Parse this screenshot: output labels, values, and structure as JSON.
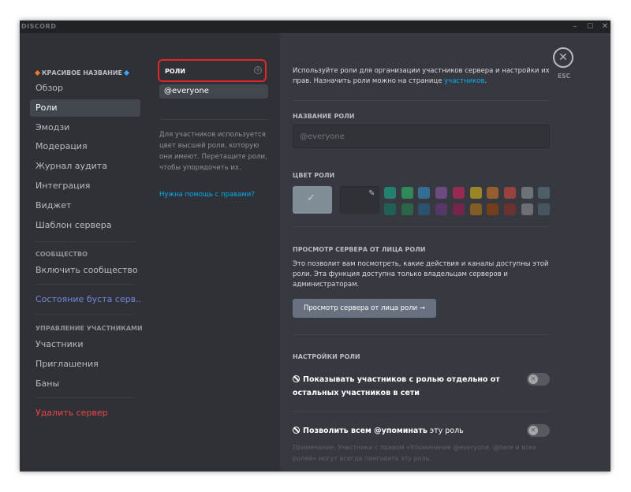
{
  "window": {
    "logo": "DISCORD",
    "minimize_glyph": "–",
    "maximize_glyph": "☐",
    "close_glyph": "✕"
  },
  "sidebar": {
    "server_name": "КРАСИВОЕ НАЗВАНИЕ",
    "items": [
      {
        "label": "Обзор"
      },
      {
        "label": "Роли",
        "selected": true
      },
      {
        "label": "Эмодзи"
      },
      {
        "label": "Модерация"
      },
      {
        "label": "Журнал аудита"
      },
      {
        "label": "Интеграция"
      },
      {
        "label": "Виджет"
      },
      {
        "label": "Шаблон сервера"
      }
    ],
    "community_header": "СООБЩЕСТВО",
    "enable_community": "Включить сообщество",
    "boost_status": "Состояние буста серв...",
    "members_header": "УПРАВЛЕНИЕ УЧАСТНИКАМИ",
    "member_items": [
      {
        "label": "Участники"
      },
      {
        "label": "Приглашения"
      },
      {
        "label": "Баны"
      }
    ],
    "delete_server": "Удалить сервер"
  },
  "roles_column": {
    "header": "РОЛИ",
    "add_glyph": "+",
    "roles": [
      {
        "name": "@everyone"
      }
    ],
    "hint": "Для участников используется цвет высшей роли, которую они имеют. Перетащите роли, чтобы упорядочить их.",
    "help_link": "Нужна помощь с правами?"
  },
  "content": {
    "intro_text": "Используйте роли для организации участников сервера и настройки их прав. Назначить роли можно на странице ",
    "intro_link": "участников",
    "intro_end": ".",
    "role_name_label": "НАЗВАНИЕ РОЛИ",
    "role_name_placeholder": "@everyone",
    "role_color_label": "ЦВЕТ РОЛИ",
    "default_color": "#99aab5",
    "check_glyph": "✓",
    "picker_glyph": "✎",
    "swatches_top": [
      "#1abc9c",
      "#2ecc71",
      "#3498db",
      "#9b59b6",
      "#e91e63",
      "#f1c40f",
      "#e67e22",
      "#e74c3c",
      "#95a5a6",
      "#607d8b"
    ],
    "swatches_bottom": [
      "#11806a",
      "#1f8b4c",
      "#206694",
      "#71368a",
      "#ad1457",
      "#c27c0e",
      "#a84300",
      "#992d22",
      "#979c9f",
      "#546e7a"
    ],
    "preview_label": "ПРОСМОТР СЕРВЕРА ОТ ЛИЦА РОЛИ",
    "preview_desc": "Это позволит вам посмотреть, какие действия и каналы доступны этой роли. Эта функция доступна только владельцам серверов и администраторам.",
    "preview_button": "Просмотр сервера от лица роли →",
    "settings_label": "НАСТРОЙКИ РОЛИ",
    "setting_hoist": "Показывать участников с ролью отдельно от остальных участников в сети",
    "setting_mention_pre": "Позволить всем ",
    "setting_mention_bold": "@упоминать",
    "setting_mention_post": " эту роль",
    "toggle_glyph": "✕",
    "note": "Примечание. Участники с правом «Упоминание @everyone, @here и всех ролей» могут всегда пинговать эту роль."
  },
  "esc": {
    "glyph": "✕",
    "label": "ESC"
  }
}
